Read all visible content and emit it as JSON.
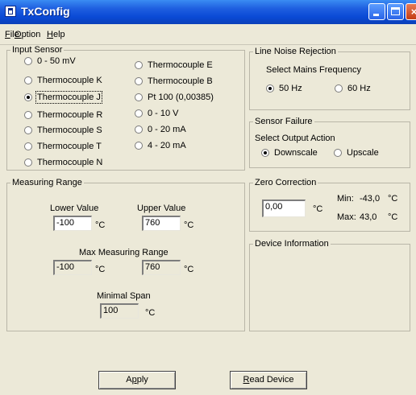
{
  "window": {
    "title": "TxConfig"
  },
  "menu": [
    {
      "label": "File",
      "accel": "F",
      "rest": "ile"
    },
    {
      "label": "Option",
      "accel": "O",
      "rest": "ption"
    },
    {
      "label": "Help",
      "accel": "H",
      "rest": "elp"
    }
  ],
  "input_sensor": {
    "title": "Input Sensor",
    "options": [
      "0 - 50 mV",
      "Thermocouple K",
      "Thermocouple J",
      "Thermocouple R",
      "Thermocouple S",
      "Thermocouple T",
      "Thermocouple N",
      "Thermocouple E",
      "Thermocouple B",
      "Pt 100 (0,00385)",
      "0 - 10 V",
      "0 - 20 mA",
      "4 - 20 mA"
    ],
    "selected": "Thermocouple J"
  },
  "line_noise": {
    "title": "Line Noise Rejection",
    "prompt": "Select Mains Frequency",
    "options": [
      "50 Hz",
      "60 Hz"
    ],
    "selected": "50 Hz"
  },
  "sensor_failure": {
    "title": "Sensor Failure",
    "prompt": "Select Output Action",
    "options": [
      "Downscale",
      "Upscale"
    ],
    "selected": "Downscale"
  },
  "measuring_range": {
    "title": "Measuring Range",
    "lower_label": "Lower Value",
    "upper_label": "Upper Value",
    "lower_value": "-100",
    "upper_value": "760",
    "unit": "°C",
    "max_label": "Max Measuring Range",
    "max_lower": "-100",
    "max_upper": "760",
    "span_label": "Minimal Span",
    "span_value": "100"
  },
  "zero_correction": {
    "title": "Zero Correction",
    "value": "0,00",
    "unit": "°C",
    "min_label": "Min:",
    "min_value": "-43,0",
    "max_label": "Max:",
    "max_value": "43,0"
  },
  "device_information": {
    "title": "Device Information"
  },
  "buttons": {
    "apply": {
      "label": "Apply",
      "accel": "p",
      "pre": "A",
      "post": "ply"
    },
    "read_device": {
      "label": "Read Device",
      "accel": "R",
      "pre": "",
      "post": "ead Device"
    }
  }
}
